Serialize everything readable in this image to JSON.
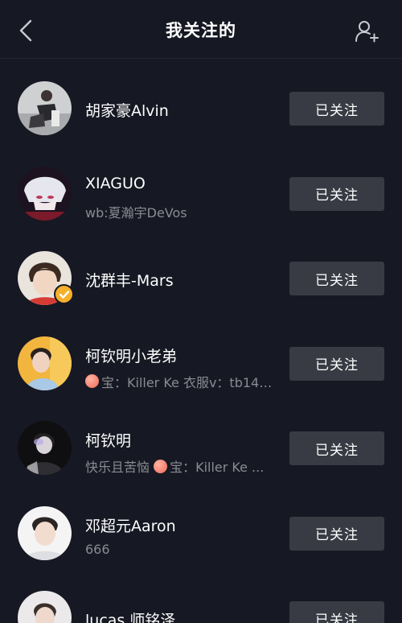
{
  "header": {
    "title": "我关注的"
  },
  "colors": {
    "background": "#161823",
    "button": "#393b44",
    "verified_badge": "#f6b12a",
    "subtext": "#8a8b92"
  },
  "following": [
    {
      "name": "胡家豪Alvin",
      "subtitle": "",
      "button_label": "已关注",
      "verified": false
    },
    {
      "name": "XIAGUO",
      "subtitle": "wb:夏瀚宇DeVos",
      "button_label": "已关注",
      "verified": false
    },
    {
      "name": "沈群丰-Mars",
      "subtitle": "",
      "button_label": "已关注",
      "verified": true
    },
    {
      "name": "柯钦明小老弟",
      "subtitle_prefix": "",
      "subtitle": "宝：Killer Ke 衣服v：tb145...",
      "button_label": "已关注",
      "verified": false
    },
    {
      "name": "柯钦明",
      "subtitle_prefix": "快乐且苦恼 ",
      "subtitle": "宝：Killer Ke ...",
      "button_label": "已关注",
      "verified": false
    },
    {
      "name": "邓超元Aaron",
      "subtitle": "666",
      "button_label": "已关注",
      "verified": false
    },
    {
      "name": "lucas 师铭泽",
      "subtitle": "",
      "button_label": "已关注",
      "verified": false
    }
  ]
}
